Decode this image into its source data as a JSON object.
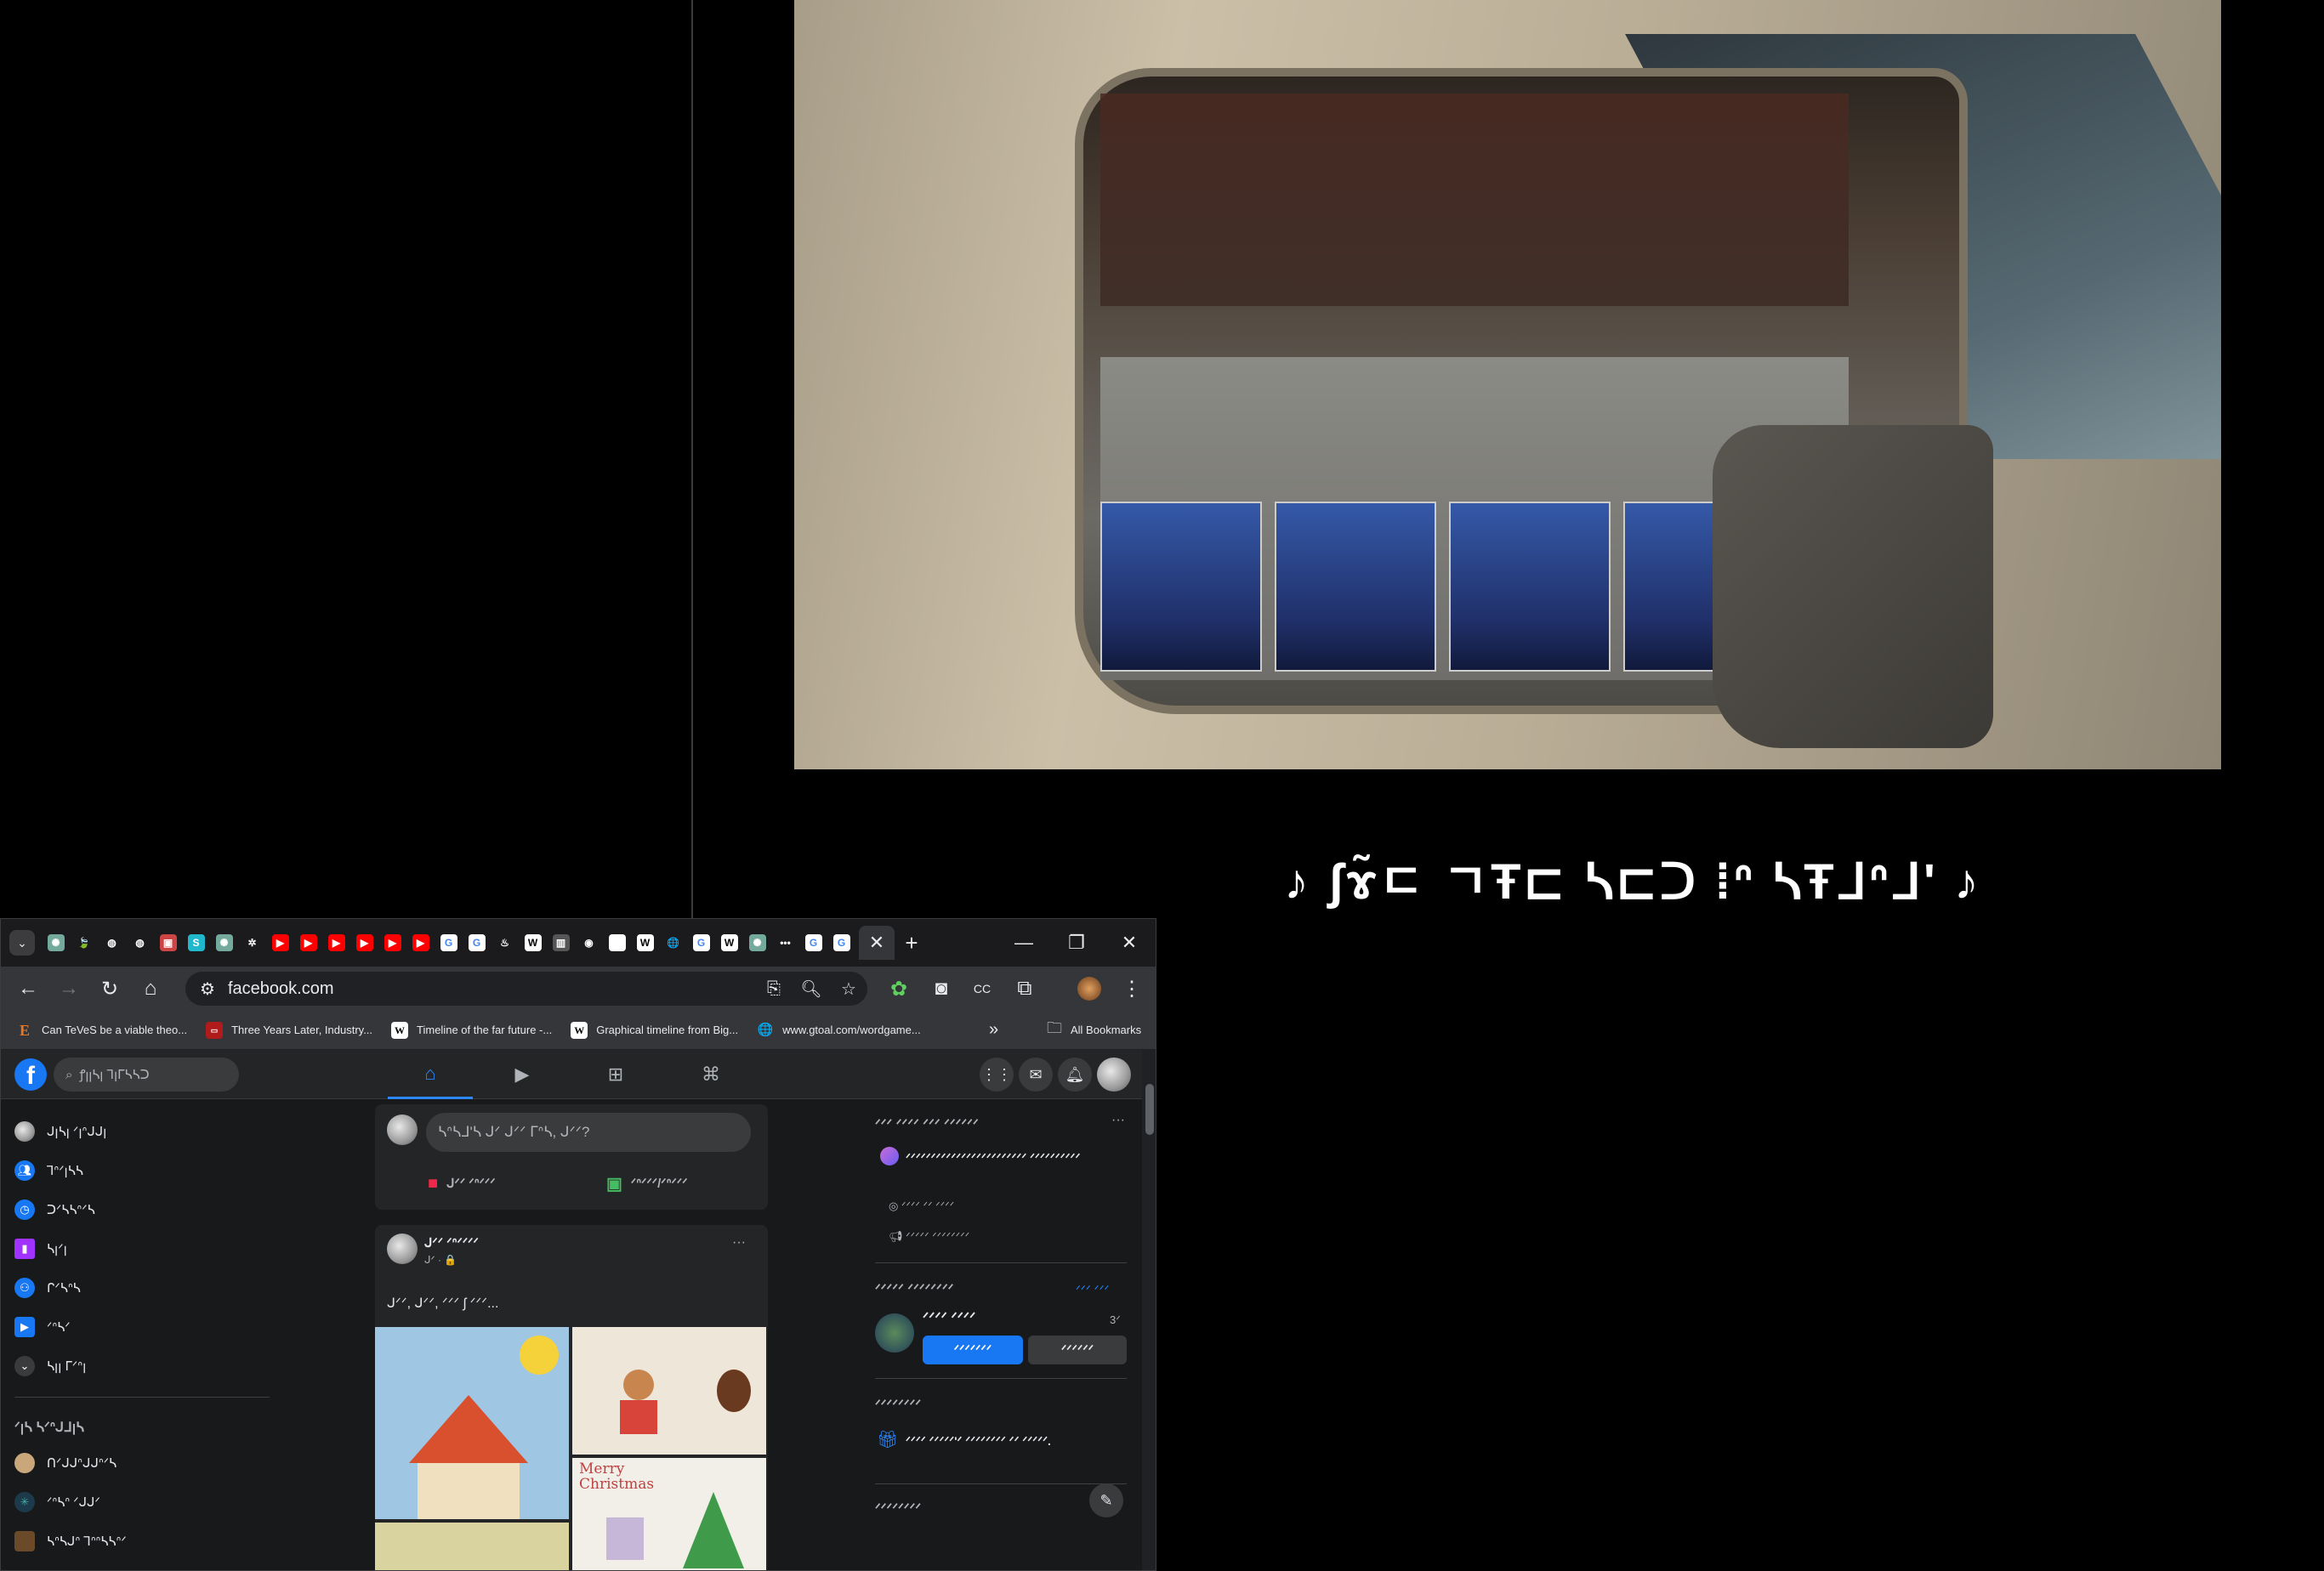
{
  "video": {
    "subtitle": "♪ ʃɤ̃ㄷ ㄱŦ⊏ ᓴ⊏ᑐ ⁞ᐢ ᓴŦᒧᐢᒧ' ♪"
  },
  "browser": {
    "tabs": {
      "menu_glyph": "⌄",
      "favicons": [
        "gpt",
        "green-leaf",
        "github",
        "github",
        "img",
        "S",
        "gpt",
        "gear",
        "youtube",
        "youtube",
        "youtube",
        "youtube",
        "youtube",
        "youtube",
        "google",
        "google",
        "steam",
        "W",
        "cube",
        "chrome",
        "blank",
        "W",
        "globe",
        "google",
        "W",
        "gpt",
        "dots",
        "google",
        "google"
      ],
      "active_close": "✕",
      "new_tab": "+",
      "minimize": "—",
      "restore": "❐",
      "close": "✕"
    },
    "toolbar": {
      "back": "←",
      "forward": "→",
      "reload": "↻",
      "home": "⌂",
      "url": "facebook.com",
      "menu": "⋮"
    },
    "bookmarks": [
      {
        "icon": "E",
        "label": "Can TeVeS be a viable theo..."
      },
      {
        "icon": "▭",
        "label": "Three Years Later, Industry..."
      },
      {
        "icon": "W",
        "label": "Timeline of the far future -..."
      },
      {
        "icon": "W",
        "label": "Graphical timeline from Big..."
      },
      {
        "icon": "🌐",
        "label": "www.gtoal.com/wordgame..."
      }
    ],
    "bookmarks_more": "»",
    "all_bookmarks": "All Bookmarks"
  },
  "facebook": {
    "logo": "f",
    "search_placeholder": "ꝭꞁꞁᓴꞁ Ꞁꞁᒥᓴᓴᑐ",
    "left_nav": [
      {
        "label": "ᒍꞁᓴꞁ ᐟꞁᐢᒍᒍꞁ",
        "icon": "avatar",
        "color": "#888"
      },
      {
        "label": "Ꞁᐢᐟꞁᓴᓴ",
        "icon": "friends",
        "color": "#1877f2"
      },
      {
        "label": "ᑐᐟᓴᓴᐢᐟᓴ",
        "icon": "memories",
        "color": "#1877f2"
      },
      {
        "label": "ᓴꞁᐟꞁ",
        "icon": "saved",
        "color": "#a033ff"
      },
      {
        "label": "ᒋᐟᓴᐢᓴ",
        "icon": "groups",
        "color": "#1877f2"
      },
      {
        "label": "ᐟᐢᓴᐟ",
        "icon": "video",
        "color": "#1877f2"
      },
      {
        "label": "ᓴꞁꞁ ᒥᐟᐢꞁ",
        "icon": "see-more",
        "color": "#3a3b3c"
      }
    ],
    "shortcuts_title": "ᐟꞁᓴ ᓴᐟᐢᒍᒧꞁᓴ",
    "shortcuts": [
      {
        "label": "ᑎᐟᒍᒍᐢᒍᒍᐢᐟᓴ",
        "color": "#c9a77a"
      },
      {
        "label": "ᐟᐢᓴᐢ ᐟᒍᒍᐟ",
        "color": "#1c3a4a"
      },
      {
        "label": "ᓴᐢᓴᒍᐢ Ꞁᐢᐢᓴᓴᐢᐟ",
        "color": "#6b4a2a"
      }
    ],
    "composer_placeholder": "ᓴᐢᓴᒧ'ᓴ ᒍᐟ ᒍᐟᐟ ᒥᐢᓴ, ᒍᐟᐟ?",
    "composer_live": "ᒍᐟᐟ ᐟᐢᐟᐟᐟ",
    "composer_photo": "ᐟᐢᐟᐟᐟ/ᐟᐢᐟᐟᐟ",
    "post": {
      "author": "ᒍᐟᐟ ᐟᐢᐟᐟᐟᐟ",
      "meta": "ᒍᐟ · 🔒",
      "text": "ᒍᐟᐟ, ᒍᐟᐟ, ᐟᐟᐟ ʃ ᐟᐟᐟ...",
      "more": "···",
      "drawing_caption": "Merry Christmas"
    },
    "right": {
      "pages_title": "ᐟᐟᐟ ᐟᐟᐟᐟ ᐟᐟᐟ ᐟᐟᐟᐟᐟᐟ",
      "page_name": "ᐟᐟᐟᐟᐟᐟᐟᐟᐟᐟᐟᐟᐟᐟᐟᐟᐟᐟᐟᐟᐟᐟᐟᐟ ᐟᐟᐟᐟᐟᐟᐟᐟᐟᐟ",
      "page_action_1": "ᐟᐟᐟᐟ ᐟᐟ ᐟᐟᐟᐟ",
      "page_action_2": "ᐟᐟᐟᐟᐟ ᐟᐟᐟᐟᐟᐟᐟᐟ",
      "friend_requests_title": "ᐟᐟᐟᐟᐟ ᐟᐟᐟᐟᐟᐟᐟᐟ",
      "see_all": "ᐟᐟᐟ ᐟᐟᐟ",
      "requester": "ᐟᐟᐟᐟ ᐟᐟᐟᐟ",
      "request_time": "3ᐟ",
      "confirm": "ᐟᐟᐟᐟᐟᐟᐟ",
      "delete": "ᐟᐟᐟᐟᐟᐟ",
      "birthdays_title": "ᐟᐟᐟᐟᐟᐟᐟᐟ",
      "birthday_text": "ᐟᐟᐟᐟ ᐟᐟᐟᐟᐟ'ᐟ ᐟᐟᐟᐟᐟᐟᐟᐟ ᐟᐟ ᐟᐟᐟᐟᐟ.",
      "contacts_title": "ᐟᐟᐟᐟᐟᐟᐟᐟ"
    }
  },
  "colors": {
    "fb_blue": "#1877f2",
    "fb_bg": "#18191a",
    "fb_card": "#242526",
    "chrome_toolbar": "#35363a"
  }
}
